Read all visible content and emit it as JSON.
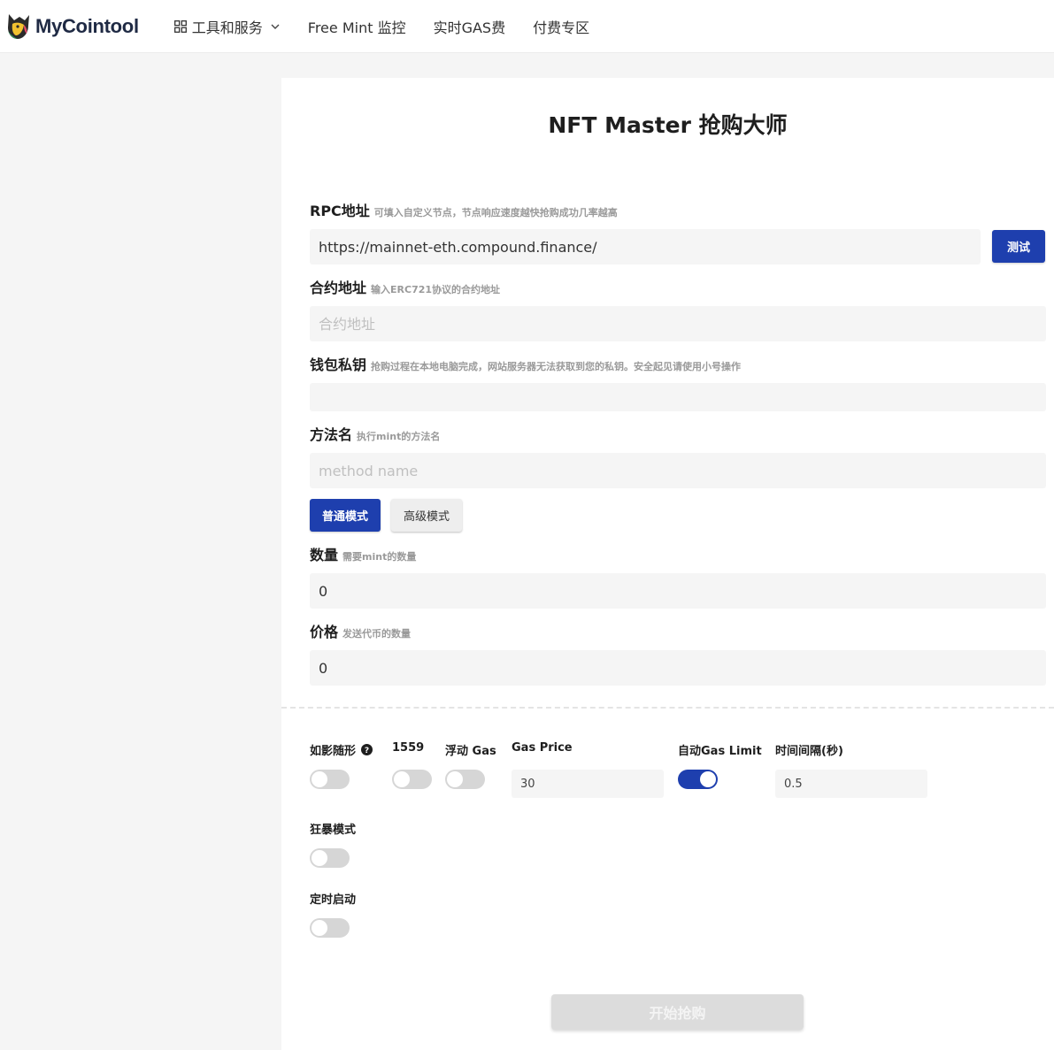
{
  "header": {
    "brand": "MyCointool",
    "nav": [
      {
        "label": "工具和服务",
        "icon": "grid-icon",
        "dropdown": true
      },
      {
        "label": "Free Mint 监控"
      },
      {
        "label": "实时GAS费"
      },
      {
        "label": "付费专区"
      }
    ]
  },
  "page": {
    "title": "NFT Master 抢购大师"
  },
  "form": {
    "rpc": {
      "label": "RPC地址",
      "hint": "可填入自定义节点，节点响应速度越快抢购成功几率越高",
      "value": "https://mainnet-eth.compound.finance/",
      "test_label": "测试"
    },
    "contract": {
      "label": "合约地址",
      "hint": "输入ERC721协议的合约地址",
      "placeholder": "合约地址"
    },
    "private_key": {
      "label": "钱包私钥",
      "hint": "抢购过程在本地电脑完成，网站服务器无法获取到您的私钥。安全起见请使用小号操作",
      "placeholder": ""
    },
    "method": {
      "label": "方法名",
      "hint": "执行mint的方法名",
      "placeholder": "method name"
    },
    "modes": {
      "normal": "普通模式",
      "advanced": "高级模式",
      "selected": "normal"
    },
    "quantity": {
      "label": "数量",
      "hint": "需要mint的数量",
      "value": "0"
    },
    "price": {
      "label": "价格",
      "hint": "发送代币的数量",
      "value": "0"
    }
  },
  "options": {
    "shadow_follow": {
      "label": "如影随形",
      "on": false
    },
    "eip1559": {
      "label": "1559",
      "on": false
    },
    "float_gas": {
      "label": "浮动 Gas",
      "on": false
    },
    "gas_price": {
      "label": "Gas Price",
      "value": "30"
    },
    "auto_gas_limit": {
      "label": "自动Gas Limit",
      "on": true
    },
    "interval": {
      "label": "时间间隔(秒)",
      "value": "0.5"
    },
    "frenzy": {
      "label": "狂暴模式",
      "on": false
    },
    "scheduled": {
      "label": "定时启动",
      "on": false
    }
  },
  "actions": {
    "start_label": "开始抢购"
  },
  "colors": {
    "accent": "#1e3fae",
    "toggle_off": "#d6d6d6",
    "disabled_button": "#dcdcdc"
  }
}
